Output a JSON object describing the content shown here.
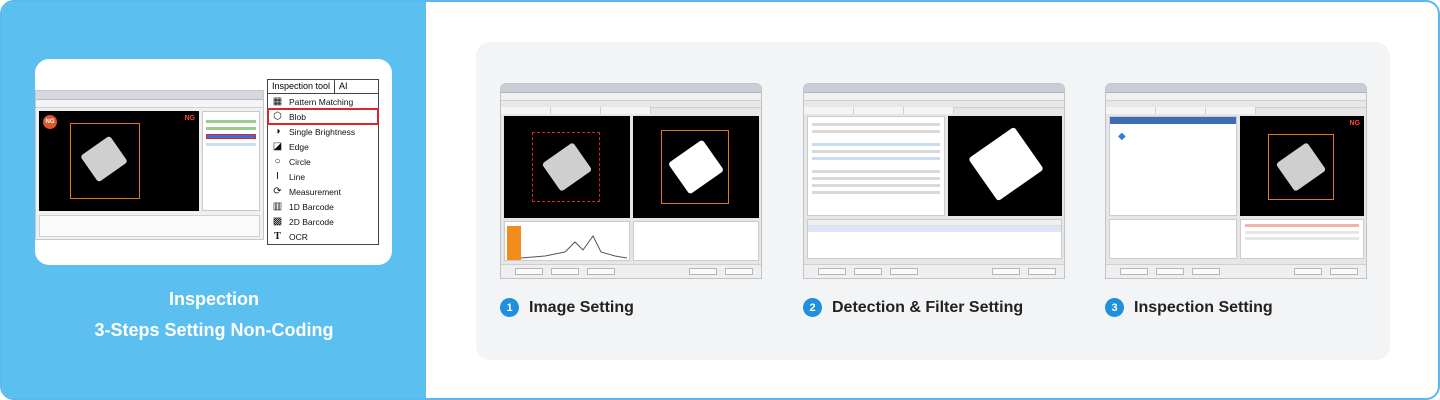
{
  "left": {
    "caption_line1": "Inspection",
    "caption_line2": "3-Steps Setting Non-Coding",
    "toolbox": {
      "tabs": [
        "Inspection tool",
        "AI"
      ],
      "items": [
        {
          "label": "Pattern Matching",
          "icon": "pattern-icon",
          "glyph": "▦"
        },
        {
          "label": "Blob",
          "icon": "blob-icon",
          "glyph": "⬡",
          "selected": true
        },
        {
          "label": "Single Brightness",
          "icon": "brightness-icon",
          "glyph": "◑"
        },
        {
          "label": "Edge",
          "icon": "edge-icon",
          "glyph": "◪"
        },
        {
          "label": "Circle",
          "icon": "circle-icon",
          "glyph": "○"
        },
        {
          "label": "Line",
          "icon": "line-icon",
          "glyph": "Ι"
        },
        {
          "label": "Measurement",
          "icon": "measurement-icon",
          "glyph": "⟳"
        },
        {
          "label": "1D Barcode",
          "icon": "barcode-icon",
          "glyph": "▥"
        },
        {
          "label": "2D Barcode",
          "icon": "qrcode-icon",
          "glyph": "▩"
        },
        {
          "label": "OCR",
          "icon": "ocr-icon",
          "glyph": "T"
        }
      ]
    },
    "ng_badge": "NG",
    "ng_label": "NG"
  },
  "steps": [
    {
      "num": "1",
      "label": "Image Setting"
    },
    {
      "num": "2",
      "label": "Detection & Filter Setting"
    },
    {
      "num": "3",
      "label": "Inspection Setting"
    }
  ],
  "shots": {
    "ng_label": "NG",
    "buttons": [
      "Rename",
      "Refresh",
      "Run",
      "OK",
      "Cancel"
    ]
  },
  "colors": {
    "accent": "#5bc0f0",
    "step_badge": "#1f8fde",
    "highlight": "#d8262c",
    "roi": "#e07a1f"
  }
}
